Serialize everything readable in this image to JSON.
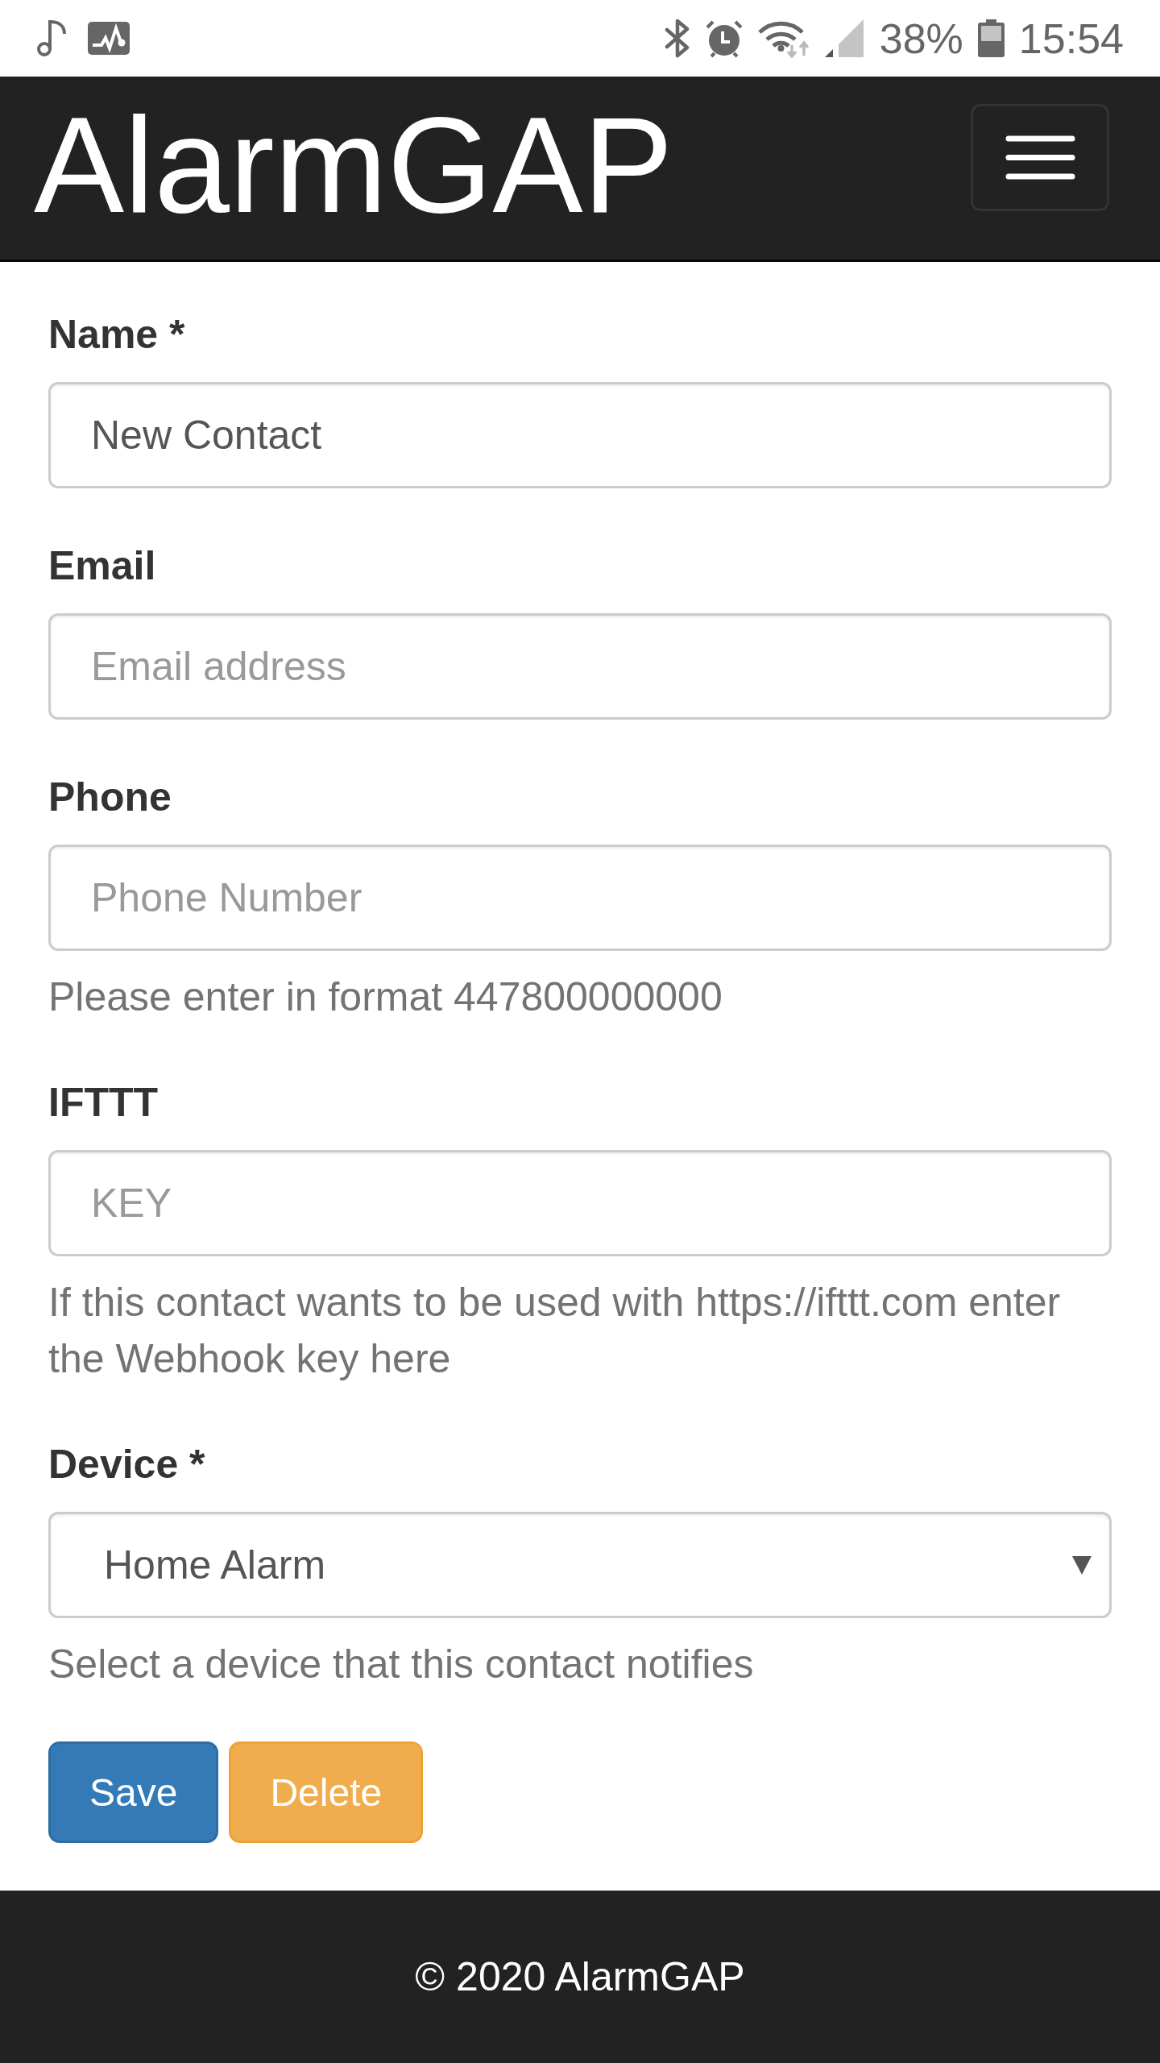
{
  "status_bar": {
    "battery_percent": "38%",
    "time": "15:54"
  },
  "navbar": {
    "brand": "AlarmGAP"
  },
  "form": {
    "fields": [
      {
        "kind": "text",
        "label": "Name *",
        "value": "New Contact"
      },
      {
        "kind": "text",
        "label": "Email",
        "placeholder": "Email address"
      },
      {
        "kind": "text",
        "label": "Phone",
        "placeholder": "Phone Number",
        "help": "Please enter in format 447800000000"
      },
      {
        "kind": "text",
        "label": "IFTTT",
        "placeholder": "KEY",
        "help": "If this contact wants to be used with https://ifttt.com enter the Webhook key here"
      },
      {
        "kind": "select",
        "label": "Device *",
        "value": "Home Alarm",
        "help": "Select a device that this contact notifies"
      }
    ],
    "buttons": [
      {
        "kind": "primary",
        "label": "Save"
      },
      {
        "kind": "warning",
        "label": "Delete"
      }
    ]
  },
  "footer": {
    "text": "© 2020 AlarmGAP"
  }
}
